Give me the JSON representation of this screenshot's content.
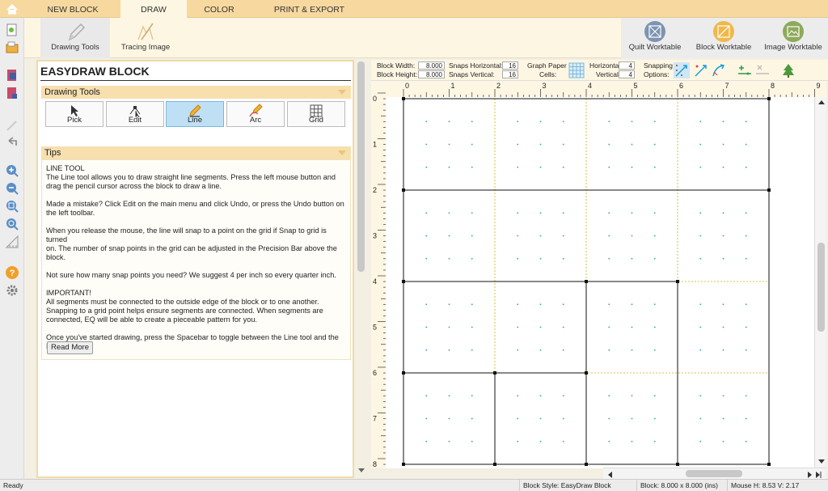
{
  "tabs": [
    {
      "label": "NEW BLOCK",
      "active": false
    },
    {
      "label": "DRAW",
      "active": true
    },
    {
      "label": "COLOR",
      "active": false
    },
    {
      "label": "PRINT & EXPORT",
      "active": false
    }
  ],
  "ribbon": {
    "drawing_tools": "Drawing Tools",
    "tracing_image": "Tracing Image",
    "quilt_worktable": "Quilt Worktable",
    "block_worktable": "Block Worktable",
    "image_worktable": "Image Worktable"
  },
  "panel": {
    "title": "EASYDRAW BLOCK",
    "drawing_tools_header": "Drawing Tools",
    "tools": [
      "Pick",
      "Edit",
      "Line",
      "Arc",
      "Grid"
    ],
    "selected_tool": "Line",
    "tips_header": "Tips",
    "tips_text": "LINE TOOL\nThe Line tool allows you to draw straight line segments. Press the left mouse button and\ndrag the pencil cursor across the block to draw a line.\n\nMade a mistake? Click Edit on the main menu and click Undo, or press the Undo button on\nthe left toolbar.\n\nWhen you release the mouse, the line will snap to a point on the grid if Snap to grid is turned\non. The number of snap points in the grid can be adjusted in the Precision Bar above the\nblock.\n\nNot sure how many snap points you need? We suggest 4 per inch so every quarter inch.\n\nIMPORTANT!\nAll segments must be connected to the outside edge of the block or to one another.\nSnapping to a grid point helps ensure segments are connected. When segments are\nconnected, EQ will be able to create a pieceable pattern for you.\n\nOnce you've started drawing, press the Spacebar to toggle between the Line tool and the\nEdit tool.",
    "read_more": "Read More"
  },
  "precision": {
    "block_width_label": "Block Width:",
    "block_width": "8.000",
    "block_height_label": "Block Height:",
    "block_height": "8.000",
    "snaps_h_label": "Snaps Horizontal:",
    "snaps_h": "16",
    "snaps_v_label": "Snaps Vertical:",
    "snaps_v": "16",
    "graph_paper_label": "Graph Paper",
    "cells_label": "Cells:",
    "horizontal_label": "Horizontal",
    "horizontal": "4",
    "vertical_label": "Vertical",
    "vertical": "4",
    "snapping_label": "Snapping",
    "options_label": "Options:"
  },
  "ruler": {
    "top": [
      "0",
      "1",
      "2",
      "3",
      "4",
      "5",
      "6",
      "7",
      "8",
      "9"
    ],
    "left": [
      "0",
      "1",
      "2",
      "3",
      "4",
      "5",
      "6",
      "7",
      "8"
    ]
  },
  "status": {
    "ready": "Ready",
    "block_style": "Block Style: EasyDraw Block",
    "block_size": "Block: 8.000 x 8.000 (ins)",
    "mouse": "Mouse  H: 8.53  V: 2.17"
  },
  "colors": {
    "accent": "#f7d9a0",
    "selected_tool": "#bfe0f4",
    "grid_dots": "#2aa59a",
    "dotted_lines": "#c9b400",
    "snap_cyan": "#1a9ed8"
  }
}
